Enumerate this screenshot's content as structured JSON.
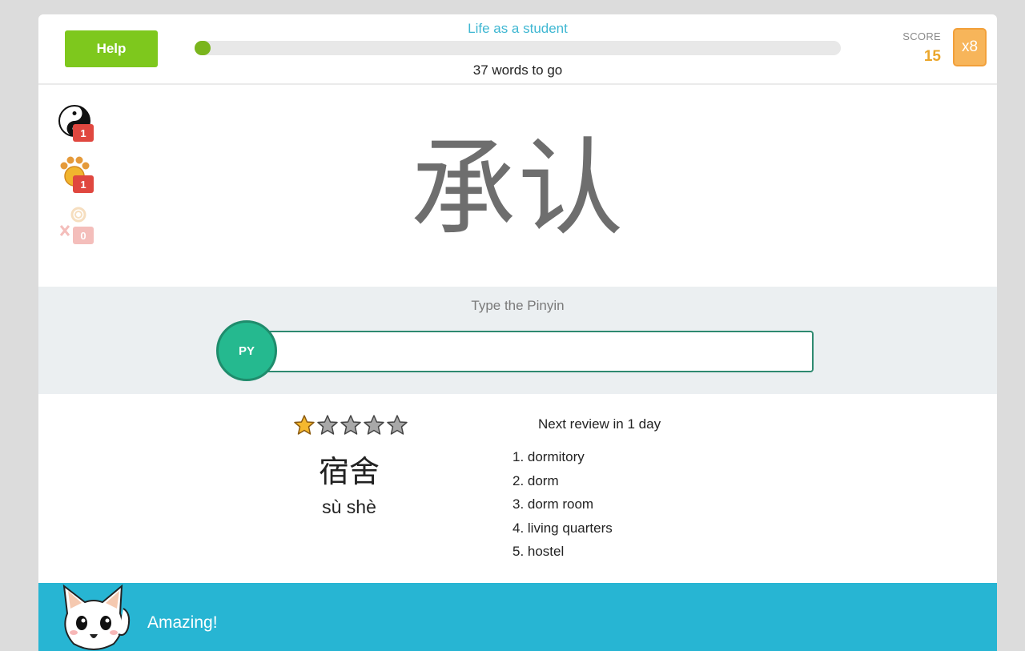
{
  "header": {
    "help_label": "Help",
    "lesson_title": "Life as a student",
    "progress_fraction": 0.01,
    "words_to_go": "37 words to go",
    "score_label": "SCORE",
    "score_value": "15",
    "multiplier": "x8"
  },
  "powerups": [
    {
      "icon": "yin-yang-icon",
      "count": "1",
      "enabled": true
    },
    {
      "icon": "paw-icon",
      "count": "1",
      "enabled": true
    },
    {
      "icon": "skip-icon",
      "count": "0",
      "enabled": false
    }
  ],
  "prompt": {
    "characters": "承认"
  },
  "answer": {
    "hint": "Type the Pinyin",
    "mode_label": "PY",
    "value": "",
    "placeholder": ""
  },
  "previous_word": {
    "rating": 1,
    "rating_max": 5,
    "characters": "宿舍",
    "pinyin": "sù shè",
    "next_review": "Next review in 1 day",
    "meanings": [
      "1. dormitory",
      "2. dorm",
      "3. dorm room",
      "4. living quarters",
      "5. hostel"
    ]
  },
  "feedback": {
    "message": "Amazing!"
  },
  "colors": {
    "accent_green": "#7ec81d",
    "teal": "#25b98f",
    "score_orange": "#eba62a",
    "footer_blue": "#27b5d3",
    "title_blue": "#3fb7d2"
  }
}
